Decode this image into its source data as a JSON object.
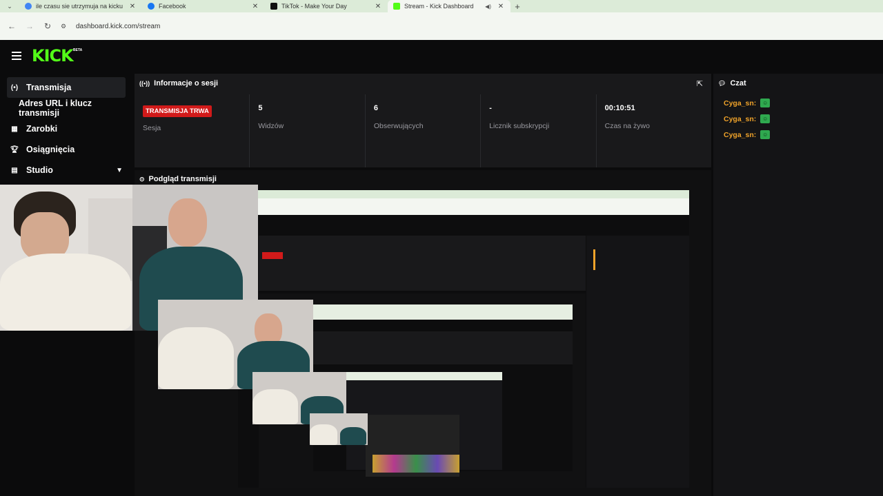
{
  "browser": {
    "tabs": [
      {
        "title": "ile czasu sie utrzymuja na kicku",
        "favicon_color": "#4285f4"
      },
      {
        "title": "Facebook",
        "favicon_color": "#1877f2"
      },
      {
        "title": "TikTok - Make Your Day",
        "favicon_color": "#111111"
      },
      {
        "title": "Stream - Kick Dashboard",
        "favicon_color": "#53fc18"
      }
    ],
    "url": "dashboard.kick.com/stream"
  },
  "header": {
    "logo": "KICK",
    "beta": "BETA"
  },
  "sidebar": {
    "items": [
      {
        "label": "Transmisja",
        "icon": "broadcast-icon"
      },
      {
        "label": "Adres URL i klucz transmisji"
      },
      {
        "label": "Zarobki",
        "icon": "chart-icon"
      },
      {
        "label": "Osiągnięcia",
        "icon": "trophy-icon"
      },
      {
        "label": "Studio",
        "icon": "studio-icon"
      }
    ]
  },
  "session": {
    "title": "Informacje o sesji",
    "badge": "TRANSMISJA TRWA",
    "session_label": "Sesja",
    "stats": [
      {
        "value": "5",
        "label": "Widzów"
      },
      {
        "value": "6",
        "label": "Obserwujących"
      },
      {
        "value": "-",
        "label": "Licznik subskrypcji"
      },
      {
        "value": "00:10:51",
        "label": "Czas na żywo"
      }
    ]
  },
  "preview": {
    "title": "Podgląd transmisji"
  },
  "chat": {
    "title": "Czat",
    "messages": [
      {
        "user": "Cyga_sn:"
      },
      {
        "user": "Cyga_sn:"
      },
      {
        "user": "Cyga_sn:"
      }
    ]
  },
  "colors": {
    "accent": "#53fc18",
    "live": "#d11a1a",
    "chat_user": "#f0a32a"
  }
}
